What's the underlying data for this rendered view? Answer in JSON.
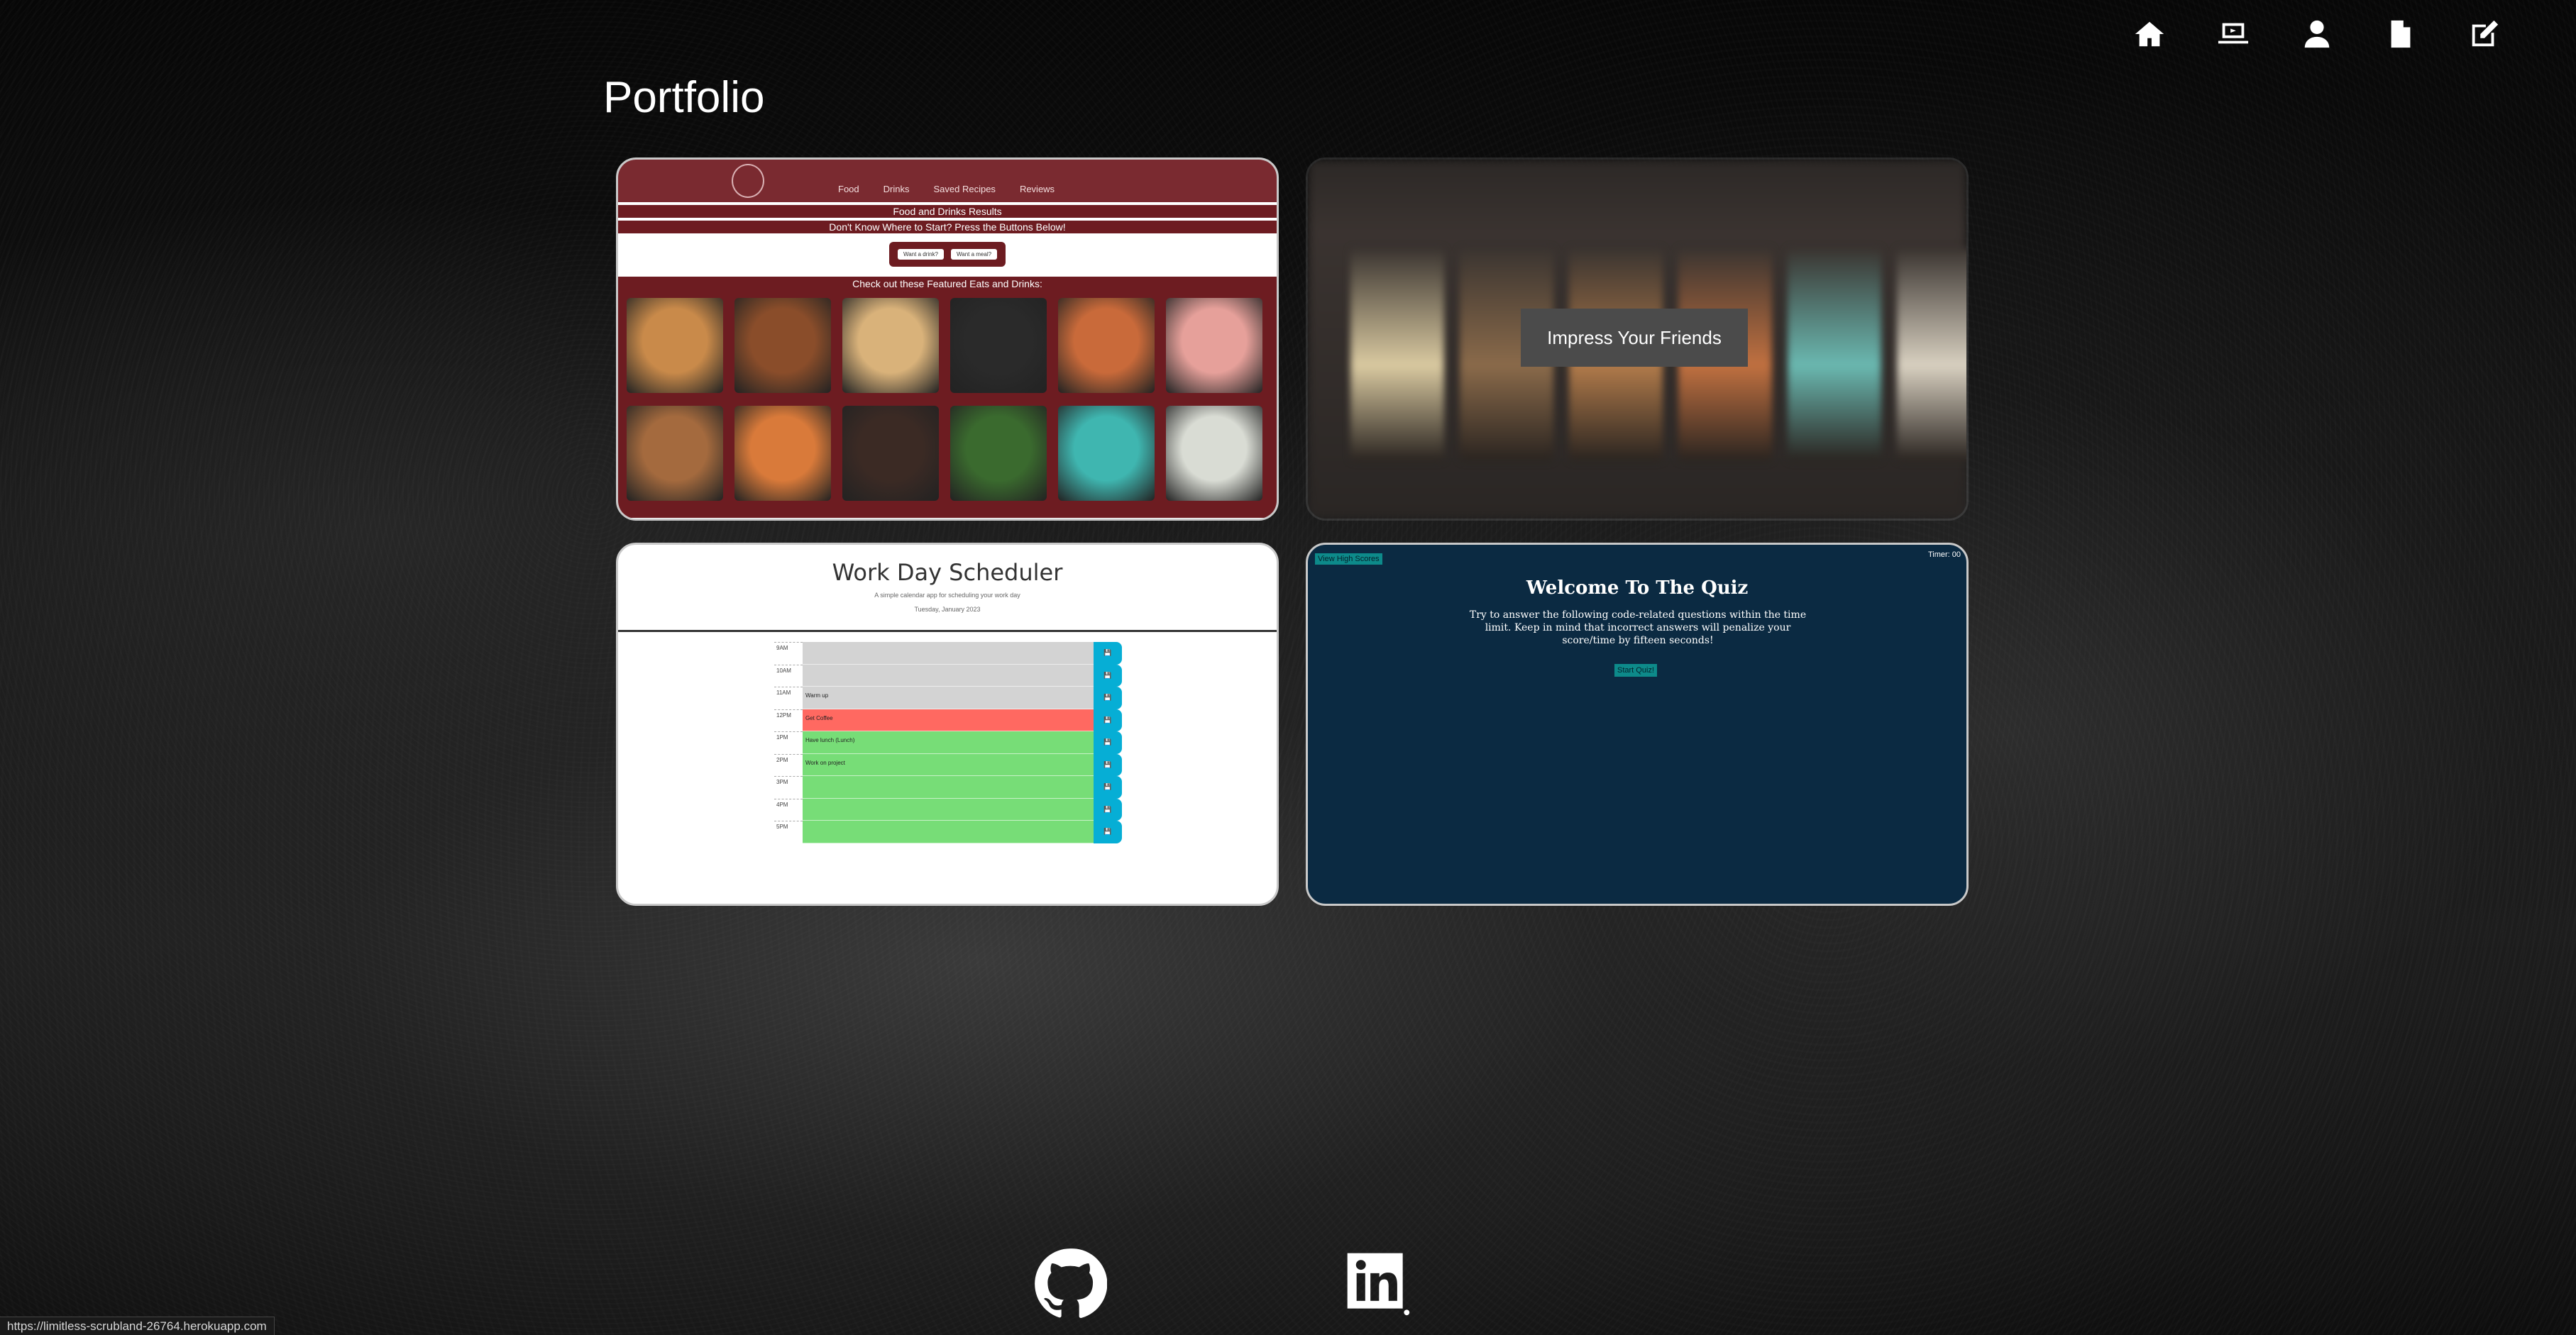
{
  "page": {
    "title": "Portfolio"
  },
  "nav": [
    {
      "name": "home",
      "icon": "home-icon"
    },
    {
      "name": "portfolio",
      "icon": "laptop-icon"
    },
    {
      "name": "about",
      "icon": "user-icon"
    },
    {
      "name": "resume",
      "icon": "file-icon"
    },
    {
      "name": "contact",
      "icon": "edit-icon"
    }
  ],
  "projects": {
    "food": {
      "links": [
        "Food",
        "Drinks",
        "Saved Recipes",
        "Reviews"
      ],
      "results": "Food and Drinks Results",
      "prompt": "Don't Know Where to Start? Press the Buttons Below!",
      "btn_drink": "Want a drink?",
      "btn_meal": "Want a meal?",
      "featured": "Check out these Featured Eats and Drinks:",
      "image_colors": [
        "#c98a4a",
        "#8a4d2a",
        "#d9b27a",
        "#2a2a2a",
        "#c96a3a",
        "#e6a09a",
        "#a46a3e",
        "#d97a3a",
        "#3b2a24",
        "#3a6a2e",
        "#3fb6b0",
        "#d9dcd4"
      ]
    },
    "impress": {
      "label": "Impress Your Friends",
      "guitar_colors": [
        "#d9c9a0",
        "#8a6a4a",
        "#b07a4a",
        "#c07040",
        "#6ab8b0",
        "#d8d0c0"
      ]
    },
    "scheduler": {
      "title": "Work Day Scheduler",
      "subtitle": "A simple calendar app for scheduling your work day",
      "date": "Tuesday, January 2023",
      "rows": [
        {
          "hour": "9AM",
          "text": "",
          "state": "past"
        },
        {
          "hour": "10AM",
          "text": "",
          "state": "past"
        },
        {
          "hour": "11AM",
          "text": "Warm up",
          "state": "past"
        },
        {
          "hour": "12PM",
          "text": "Get Coffee",
          "state": "present"
        },
        {
          "hour": "1PM",
          "text": "Have lunch (Lunch)",
          "state": "future"
        },
        {
          "hour": "2PM",
          "text": "Work on project",
          "state": "future"
        },
        {
          "hour": "3PM",
          "text": "",
          "state": "future"
        },
        {
          "hour": "4PM",
          "text": "",
          "state": "future"
        },
        {
          "hour": "5PM",
          "text": "",
          "state": "future"
        }
      ],
      "save_glyph": "💾"
    },
    "quiz": {
      "high_scores": "View High Scores",
      "timer": "Timer: 00",
      "title": "Welcome To The Quiz",
      "text": "Try to answer the following code-related questions within the time limit. Keep in mind that incorrect answers will penalize your score/time by fifteen seconds!",
      "start": "Start Quiz!"
    }
  },
  "footer": {
    "github": "github-icon",
    "linkedin": "linkedin-icon"
  },
  "status_url": "https://limitless-scrubland-26764.herokuapp.com"
}
